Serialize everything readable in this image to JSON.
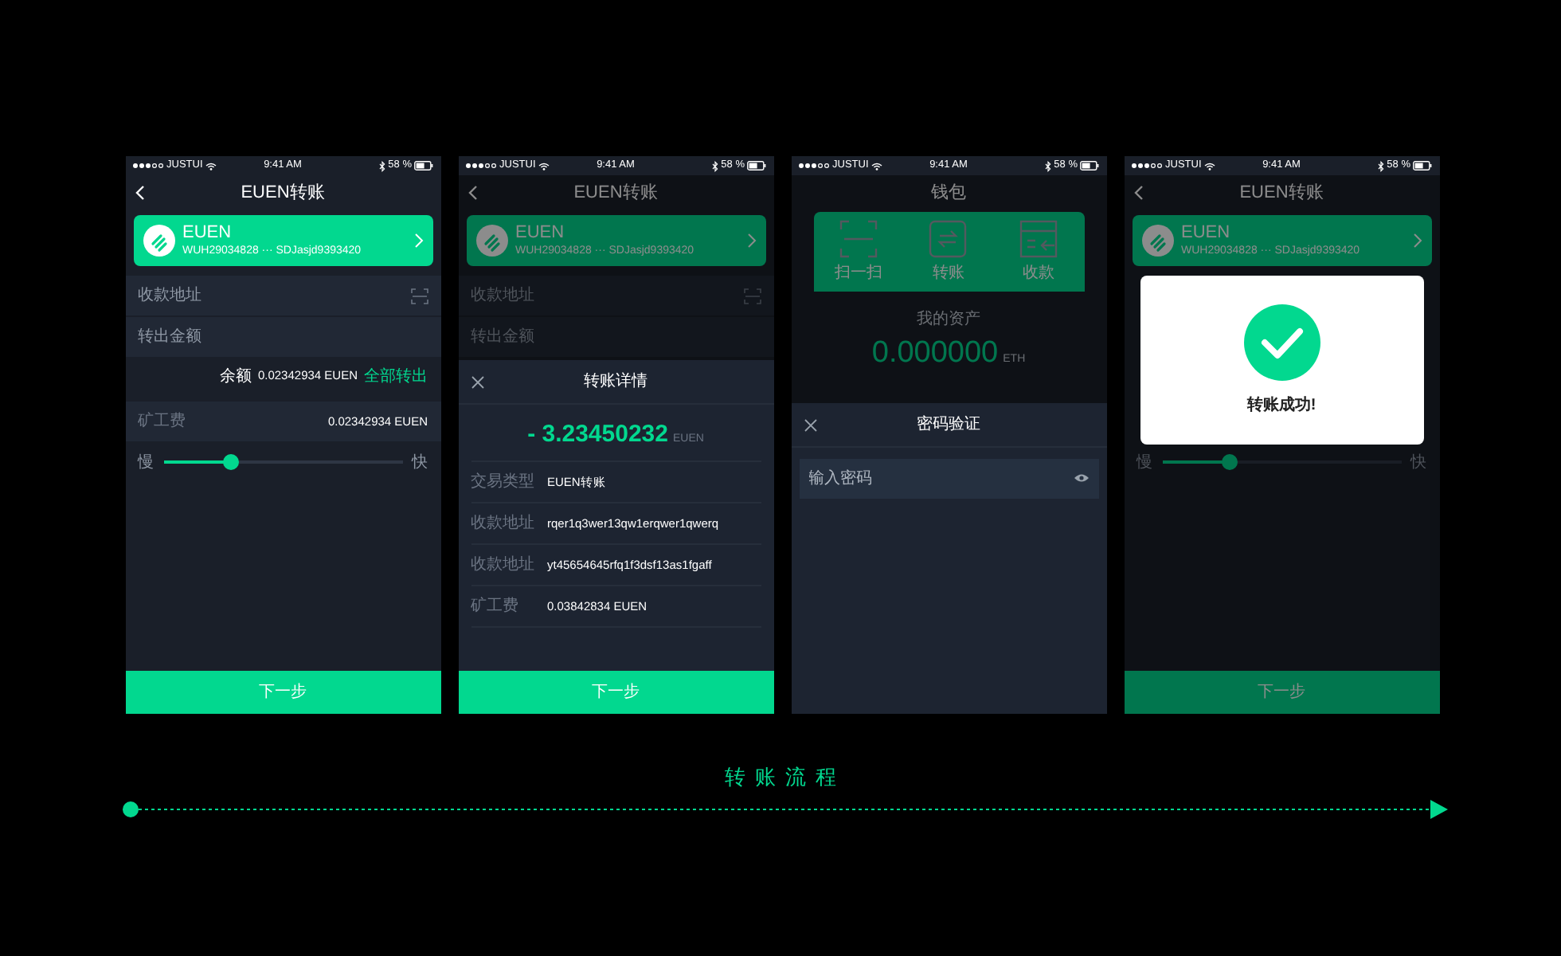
{
  "screens": [
    {
      "kind": "transfer",
      "dimmed": false,
      "status_bar": {
        "carrier": "JUSTUI",
        "time": "9:41 AM",
        "battery": "58 %"
      },
      "title": "EUEN转账",
      "wallet_card": {
        "name": "EUEN",
        "address": "WUH29034828 ··· SDJasjd9393420"
      },
      "fields": [
        {
          "label": "收款地址",
          "scan": true
        },
        {
          "label": "转出金额",
          "scan": false
        }
      ],
      "balance": {
        "label": "余额",
        "value": "0.02342934 EUEN",
        "action": "全部转出"
      },
      "fee": {
        "label": "矿工费",
        "value": "0.02342934 EUEN"
      },
      "speed": {
        "slow": "慢",
        "fast": "快",
        "level": 0.28
      },
      "next_button": "下一步"
    },
    {
      "kind": "transfer",
      "dimmed": true,
      "status_bar": {
        "carrier": "JUSTUI",
        "time": "9:41 AM",
        "battery": "58 %"
      },
      "title": "EUEN转账",
      "wallet_card": {
        "name": "EUEN",
        "address": "WUH29034828 ··· SDJasjd9393420"
      },
      "fields": [
        {
          "label": "收款地址",
          "scan": true
        },
        {
          "label": "转出金额",
          "scan": false
        }
      ],
      "sheet": {
        "kind": "details",
        "title": "转账详情",
        "amount": "- 3.23450232",
        "unit": "EUEN",
        "rows": [
          {
            "label": "交易类型",
            "value": "EUEN转账"
          },
          {
            "label": "收款地址",
            "value": "rqer1q3wer13qw1erqwer1qwerq"
          },
          {
            "label": "收款地址",
            "value": "yt45654645rfq1f3dsf13as1fgaff"
          },
          {
            "label": "矿工费",
            "value": "0.03842834 EUEN"
          }
        ],
        "button": "下一步"
      }
    },
    {
      "kind": "wallet",
      "dimmed": true,
      "status_bar": {
        "carrier": "JUSTUI",
        "time": "9:41 AM",
        "battery": "58 %"
      },
      "title": "钱包",
      "actions": [
        {
          "kind": "scan",
          "label": "扫一扫"
        },
        {
          "kind": "transfer",
          "label": "转账"
        },
        {
          "kind": "receive",
          "label": "收款"
        }
      ],
      "assets": {
        "label": "我的资产",
        "value": "0.000000",
        "unit": "ETH"
      },
      "sheet": {
        "kind": "password",
        "title": "密码验证",
        "placeholder": "输入密码"
      }
    },
    {
      "kind": "transfer",
      "dimmed": true,
      "status_bar": {
        "carrier": "JUSTUI",
        "time": "9:41 AM",
        "battery": "58 %"
      },
      "title": "EUEN转账",
      "wallet_card": {
        "name": "EUEN",
        "address": "WUH29034828 ··· SDJasjd9393420"
      },
      "speed": {
        "slow": "慢",
        "fast": "快",
        "level": 0.28
      },
      "next_button": "下一步",
      "dialog": {
        "message": "转账成功!"
      }
    }
  ],
  "flow_label": "转账流程"
}
